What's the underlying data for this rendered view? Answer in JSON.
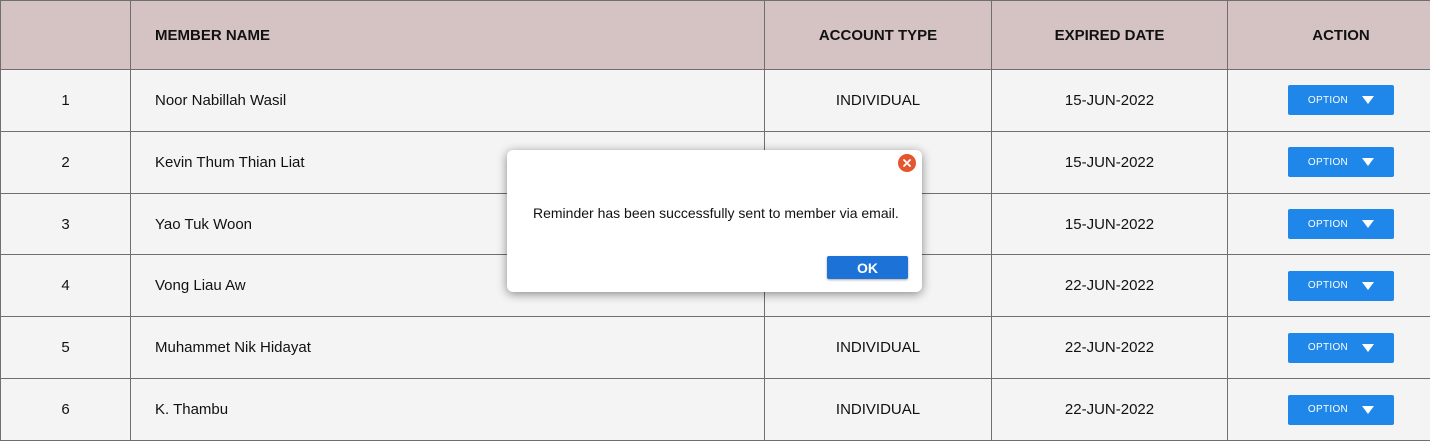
{
  "table": {
    "headers": {
      "number": "",
      "member_name": "MEMBER NAME",
      "account_type": "ACCOUNT TYPE",
      "expired_date": "EXPIRED DATE",
      "action": "ACTION"
    },
    "rows": [
      {
        "number": "1",
        "member_name": "Noor Nabillah Wasil",
        "account_type": "INDIVIDUAL",
        "expired_date": "15-JUN-2022",
        "action_label": "OPTION"
      },
      {
        "number": "2",
        "member_name": "Kevin Thum Thian Liat",
        "account_type": "",
        "expired_date": "15-JUN-2022",
        "action_label": "OPTION"
      },
      {
        "number": "3",
        "member_name": "Yao Tuk Woon",
        "account_type": "",
        "expired_date": "15-JUN-2022",
        "action_label": "OPTION"
      },
      {
        "number": "4",
        "member_name": "Vong Liau Aw",
        "account_type": "",
        "expired_date": "22-JUN-2022",
        "action_label": "OPTION"
      },
      {
        "number": "5",
        "member_name": "Muhammet Nik Hidayat",
        "account_type": "INDIVIDUAL",
        "expired_date": "22-JUN-2022",
        "action_label": "OPTION"
      },
      {
        "number": "6",
        "member_name": "K. Thambu",
        "account_type": "INDIVIDUAL",
        "expired_date": "22-JUN-2022",
        "action_label": "OPTION"
      }
    ]
  },
  "dialog": {
    "message": "Reminder has been successfully sent to member via email.",
    "ok_label": "OK",
    "close_icon": "close-icon"
  },
  "colors": {
    "header_bg": "#d5c3c3",
    "row_bg": "#f4f4f4",
    "option_button": "#1f87ea",
    "ok_button": "#1d72d8",
    "close_icon": "#e4572e"
  }
}
